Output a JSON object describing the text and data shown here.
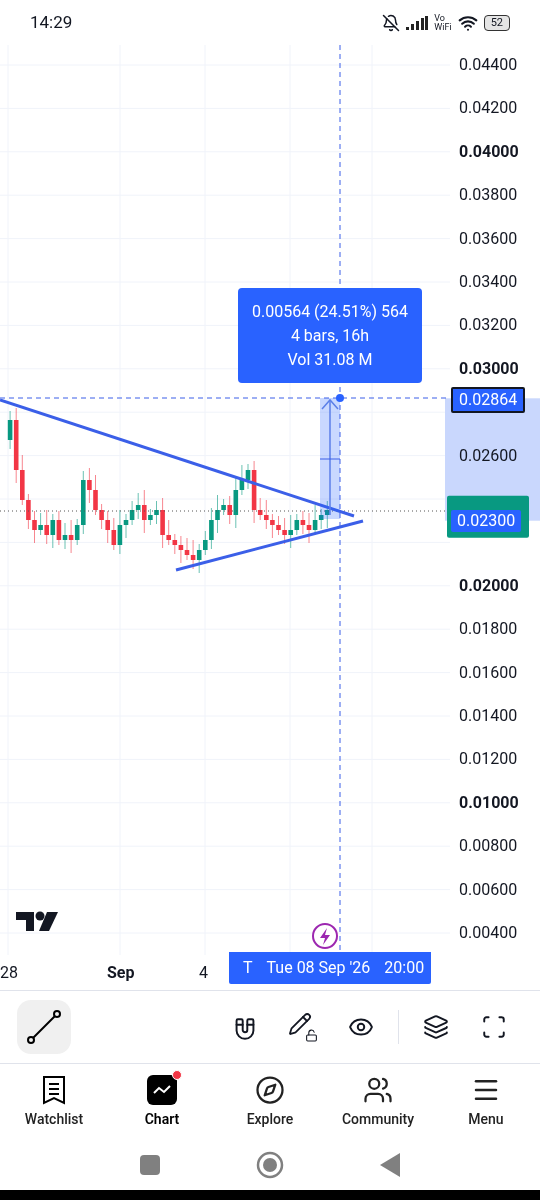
{
  "status_bar": {
    "time": "14:29",
    "vowifi": [
      "Vo",
      "WiFi"
    ],
    "battery": "52"
  },
  "chart": {
    "price_axis": [
      {
        "label": "0.04400",
        "bold": false
      },
      {
        "label": "0.04200",
        "bold": false
      },
      {
        "label": "0.04000",
        "bold": true
      },
      {
        "label": "0.03800",
        "bold": false
      },
      {
        "label": "0.03600",
        "bold": false
      },
      {
        "label": "0.03400",
        "bold": false
      },
      {
        "label": "0.03200",
        "bold": false
      },
      {
        "label": "0.03000",
        "bold": true
      },
      {
        "label": "0.02600",
        "bold": false
      },
      {
        "label": "0.02000",
        "bold": true
      },
      {
        "label": "0.01800",
        "bold": false
      },
      {
        "label": "0.01600",
        "bold": false
      },
      {
        "label": "0.01400",
        "bold": false
      },
      {
        "label": "0.01200",
        "bold": false
      },
      {
        "label": "0.01000",
        "bold": true
      },
      {
        "label": "0.00800",
        "bold": false
      },
      {
        "label": "0.00600",
        "bold": false
      },
      {
        "label": "0.00400",
        "bold": false
      }
    ],
    "price_tags": [
      {
        "label": "0.02864",
        "kind": "target"
      },
      {
        "label": "0.02300",
        "kind": "current"
      }
    ],
    "measure": {
      "lines": [
        "0.00564 (24.51%) 564",
        "4 bars, 16h",
        "Vol 31.08 M"
      ]
    },
    "time_axis": [
      {
        "label": "28",
        "bold": false
      },
      {
        "label": "Sep",
        "bold": true
      },
      {
        "label": "4",
        "bold": false
      }
    ],
    "time_tag": {
      "prefix": "T",
      "date": "Tue 08 Sep '26",
      "time": "20:00"
    }
  },
  "tools": [
    {
      "kind": "line",
      "selected": true
    },
    {
      "kind": "magnet",
      "selected": false
    },
    {
      "kind": "pencil-lock",
      "selected": false
    },
    {
      "kind": "eye",
      "selected": false
    },
    {
      "kind": "layers",
      "selected": false
    },
    {
      "kind": "fullscreen",
      "selected": false
    }
  ],
  "nav": [
    {
      "label": "Watchlist",
      "kind": "watchlist",
      "selected": false,
      "badge": false
    },
    {
      "label": "Chart",
      "kind": "chart",
      "selected": true,
      "badge": true
    },
    {
      "label": "Explore",
      "kind": "explore",
      "selected": false,
      "badge": false
    },
    {
      "label": "Community",
      "kind": "community",
      "selected": false,
      "badge": false
    },
    {
      "label": "Menu",
      "kind": "menu",
      "selected": false,
      "badge": false
    }
  ]
}
